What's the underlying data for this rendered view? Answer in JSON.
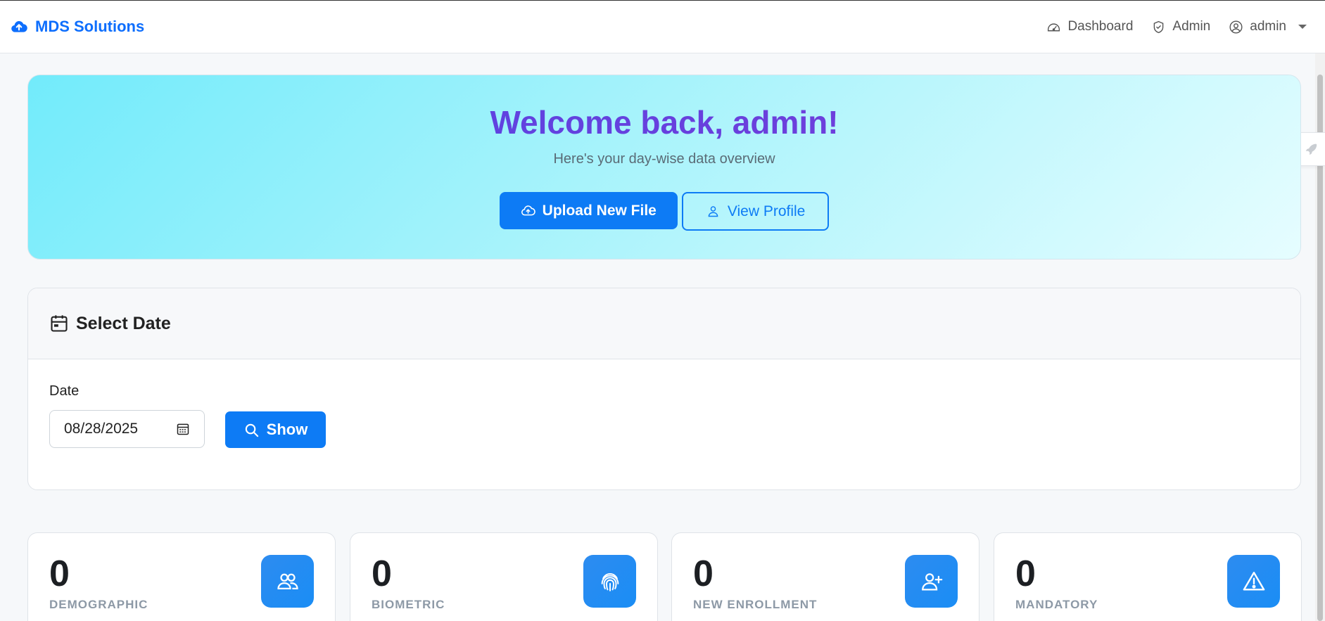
{
  "navbar": {
    "brand": "MDS Solutions",
    "links": [
      {
        "label": "Dashboard",
        "icon": "speedometer-icon"
      },
      {
        "label": "Admin",
        "icon": "shield-icon"
      },
      {
        "label": "admin",
        "icon": "user-circle-icon"
      }
    ]
  },
  "hero": {
    "title": "Welcome back, admin!",
    "subtitle": "Here's your day-wise data overview",
    "upload_label": "Upload New File",
    "profile_label": "View Profile"
  },
  "date_card": {
    "title": "Select Date",
    "date_label": "Date",
    "date_value": "08/28/2025",
    "show_label": "Show"
  },
  "stats": [
    {
      "value": "0",
      "label": "DEMOGRAPHIC",
      "icon": "people-icon"
    },
    {
      "value": "0",
      "label": "BIOMETRIC",
      "icon": "fingerprint-icon"
    },
    {
      "value": "0",
      "label": "NEW ENROLLMENT",
      "icon": "person-add-icon"
    },
    {
      "value": "0",
      "label": "MANDATORY",
      "icon": "warning-icon"
    }
  ],
  "colors": {
    "primary": "#0d7bf5",
    "brand": "#0d6efd",
    "hero_start": "#72ebfb",
    "hero_end": "#e6fdff",
    "title_start": "#4f46e5",
    "title_end": "#7e3bd6"
  }
}
